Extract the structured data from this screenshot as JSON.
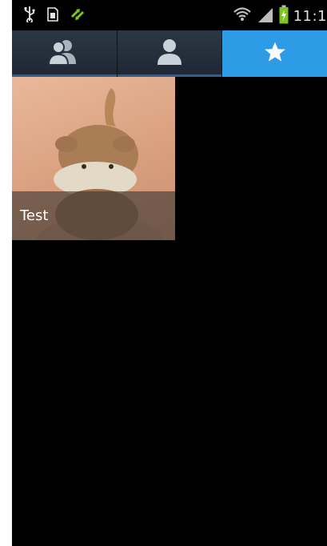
{
  "status_bar": {
    "time": "11:1",
    "icons": [
      "usb-icon",
      "sim-card-icon",
      "sync-arrows-icon",
      "wifi-icon",
      "signal-bars-icon",
      "battery-charging-icon"
    ]
  },
  "tabs": [
    {
      "name": "groups",
      "icon": "people-icon",
      "active": false
    },
    {
      "name": "contacts",
      "icon": "person-icon",
      "active": false
    },
    {
      "name": "favorites",
      "icon": "star-icon",
      "active": true
    }
  ],
  "favorites": {
    "items": [
      {
        "name": "Test"
      }
    ]
  },
  "colors": {
    "active_tab": "#2e9be6",
    "tab_bar": "#263240",
    "background": "#000000"
  }
}
